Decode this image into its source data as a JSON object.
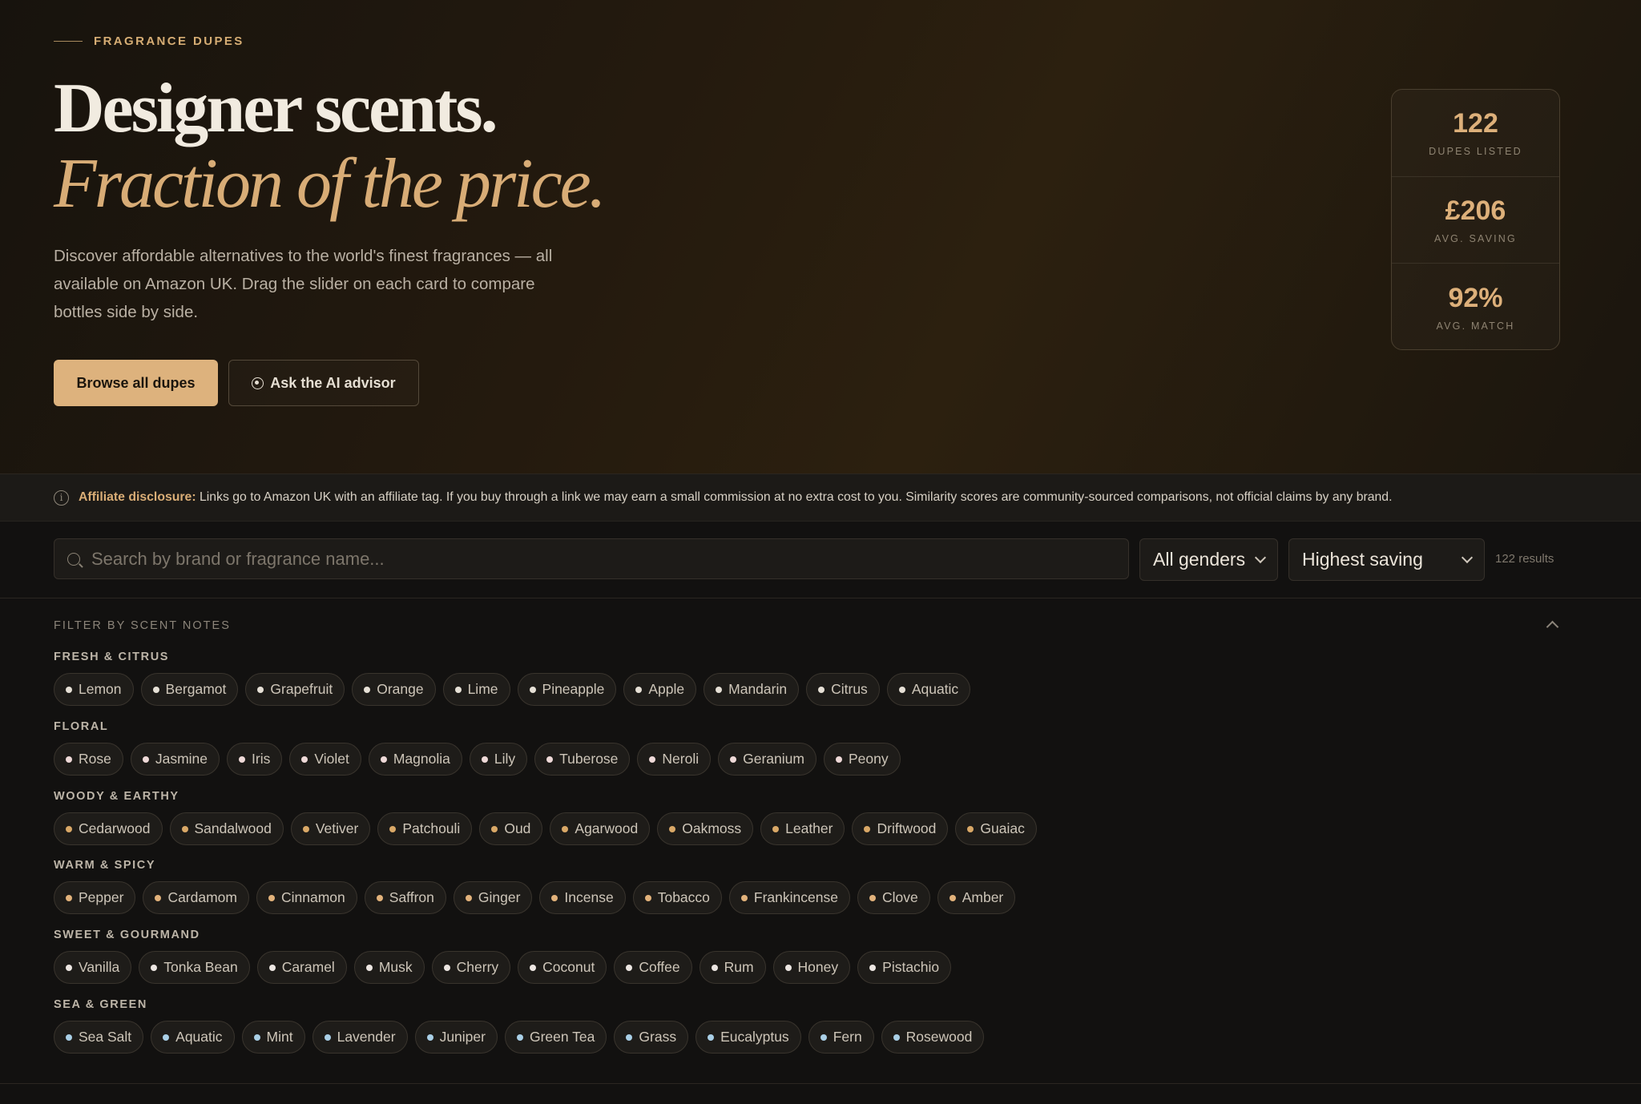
{
  "hero": {
    "eyebrow": "FRAGRANCE DUPES",
    "title_line1": "Designer scents.",
    "title_line2": "Fraction of the price.",
    "lede": "Discover affordable alternatives to the world's finest fragrances — all available on Amazon UK. Drag the slider on each card to compare bottles side by side.",
    "primary_button": "Browse all dupes",
    "secondary_button": "Ask the AI advisor"
  },
  "stats": [
    {
      "value": "122",
      "label": "DUPES LISTED"
    },
    {
      "value": "£206",
      "label": "AVG. SAVING"
    },
    {
      "value": "92%",
      "label": "AVG. MATCH"
    }
  ],
  "disclosure": {
    "label": "Affiliate disclosure:",
    "text": "Links go to Amazon UK with an affiliate tag. If you buy through a link we may earn a small commission at no extra cost to you. Similarity scores are community-sourced comparisons, not official claims by any brand."
  },
  "toolbar": {
    "search_placeholder": "Search by brand or fragrance name...",
    "gender_value": "All genders",
    "sort_value": "Highest saving",
    "results": "122 results"
  },
  "filters": {
    "heading": "FILTER BY SCENT NOTES",
    "groups": [
      {
        "title": "FRESH & CITRUS",
        "dot_color": "#e6e0d6",
        "notes": [
          "Lemon",
          "Bergamot",
          "Grapefruit",
          "Orange",
          "Lime",
          "Pineapple",
          "Apple",
          "Mandarin",
          "Citrus",
          "Aquatic"
        ]
      },
      {
        "title": "FLORAL",
        "dot_color": "#eed9d8",
        "notes": [
          "Rose",
          "Jasmine",
          "Iris",
          "Violet",
          "Magnolia",
          "Lily",
          "Tuberose",
          "Neroli",
          "Geranium",
          "Peony"
        ]
      },
      {
        "title": "WOODY & EARTHY",
        "dot_color": "#d9a867",
        "notes": [
          "Cedarwood",
          "Sandalwood",
          "Vetiver",
          "Patchouli",
          "Oud",
          "Agarwood",
          "Oakmoss",
          "Leather",
          "Driftwood",
          "Guaiac"
        ]
      },
      {
        "title": "WARM & SPICY",
        "dot_color": "#e2b27b",
        "notes": [
          "Pepper",
          "Cardamom",
          "Cinnamon",
          "Saffron",
          "Ginger",
          "Incense",
          "Tobacco",
          "Frankincense",
          "Clove",
          "Amber"
        ]
      },
      {
        "title": "SWEET & GOURMAND",
        "dot_color": "#ece6e2",
        "notes": [
          "Vanilla",
          "Tonka Bean",
          "Caramel",
          "Musk",
          "Cherry",
          "Coconut",
          "Coffee",
          "Rum",
          "Honey",
          "Pistachio"
        ]
      },
      {
        "title": "SEA & GREEN",
        "dot_color": "#a9cfe6",
        "notes": [
          "Sea Salt",
          "Aquatic",
          "Mint",
          "Lavender",
          "Juniper",
          "Green Tea",
          "Grass",
          "Eucalyptus",
          "Fern",
          "Rosewood"
        ]
      }
    ]
  }
}
